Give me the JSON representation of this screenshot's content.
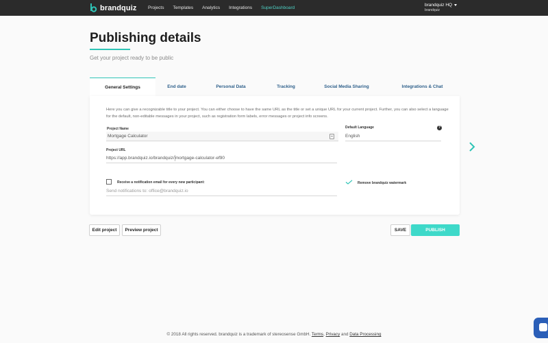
{
  "nav": {
    "brand": "brandquiz",
    "items": [
      {
        "label": "Projects",
        "active": false
      },
      {
        "label": "Templates",
        "active": false
      },
      {
        "label": "Analytics",
        "active": false
      },
      {
        "label": "Integrations",
        "active": false
      },
      {
        "label": "SuperDashboard",
        "active": true
      }
    ],
    "account": {
      "name": "brandquiz HQ",
      "sub": "brandquiz"
    }
  },
  "page": {
    "title": "Publishing details",
    "subtitle": "Get your project ready to be public"
  },
  "tabs": [
    {
      "label": "General Settings",
      "active": true
    },
    {
      "label": "End date",
      "active": false
    },
    {
      "label": "Personal Data",
      "active": false
    },
    {
      "label": "Tracking",
      "active": false
    },
    {
      "label": "Social Media Sharing",
      "active": false
    },
    {
      "label": "Integrations & Chat",
      "active": false
    }
  ],
  "general": {
    "intro": "Here you can give a recognizable title to your project. You can either choose to have the same URL as the title or set a unique URL for your current project. Further, you can also select a language for the default, non-editable messages in your project, such as registration form labels, error messages or project info screens.",
    "project_name_label": "Project Name",
    "project_name_value": "Mortgage Calculator",
    "default_language_label": "Default Language",
    "default_language_value": "English",
    "project_url_label": "Project URL",
    "project_url_prefix": "https://app.brandquiz.io/brandquiz/",
    "project_url_slug": "mortgage-calculator-ef90",
    "notification_label": "Receive a notification email for every new participant:",
    "notification_checked": false,
    "notification_placeholder": "Send notifications to: office@brandquiz.io",
    "watermark_label": "Remove brandquiz watermark",
    "watermark_checked": true,
    "help_glyph": "?"
  },
  "actions": {
    "edit": "Edit project",
    "preview": "Preview project",
    "save": "SAVE",
    "publish": "PUBLISH"
  },
  "footer": {
    "text": "© 2018 All rights reserved. brandquiz is a trademark of stereosense GmbH.",
    "terms": "Terms",
    "comma": ",",
    "privacy": "Privacy",
    "and": "and",
    "data_processing": "Data Processing"
  },
  "colors": {
    "accent": "#2ec4b6",
    "nav_bg": "#2b2b2b",
    "publish": "#3ed9c9",
    "tab_text": "#2d5f8a"
  },
  "icons": {
    "calendar": "calendar-icon",
    "help": "help-icon",
    "check": "checkmark-icon",
    "arrow": "chevron-right-icon",
    "chat": "chat-icon"
  }
}
